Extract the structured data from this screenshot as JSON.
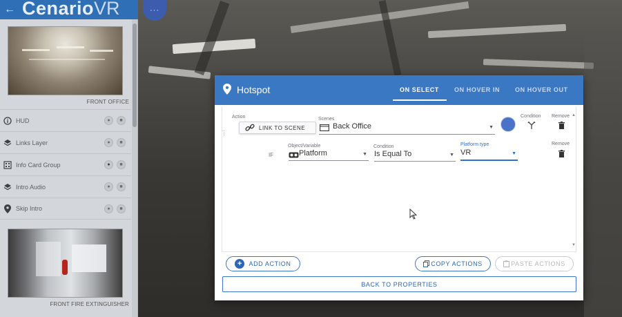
{
  "app": {
    "brand": "Cenario",
    "brand_suffix": "VR",
    "back_glyph": "←",
    "menu_glyph": "···"
  },
  "sidebar": {
    "scenes": [
      {
        "caption": "FRONT OFFICE",
        "thumbnail": "office-panorama"
      },
      {
        "caption": "FRONT FIRE EXTINGUISHER",
        "thumbnail": "corridor-panorama"
      }
    ],
    "layers": [
      {
        "label": "HUD",
        "icon": "info-circle-icon"
      },
      {
        "label": "Links Layer",
        "icon": "layers-icon"
      },
      {
        "label": "Info Card Group",
        "icon": "grid-icon"
      },
      {
        "label": "Intro Audio",
        "icon": "layers-icon"
      },
      {
        "label": "Skip Intro",
        "icon": "map-pin-icon"
      }
    ]
  },
  "dialog": {
    "title": "Hotspot",
    "tabs": [
      {
        "label": "ON SELECT",
        "active": true
      },
      {
        "label": "ON HOVER IN",
        "active": false
      },
      {
        "label": "ON HOVER OUT",
        "active": false
      }
    ],
    "action": {
      "action_label": "Action",
      "action_button": "LINK TO SCENE",
      "scenes_label": "Scenes",
      "scene_value": "Back Office",
      "condition_label": "Condition",
      "remove_label": "Remove",
      "swatch_color": "#4a72c9"
    },
    "condition_row": {
      "if_label": "IF",
      "object_label": "Object/Variable",
      "object_value": "Platform",
      "condition_label": "Condition",
      "condition_value": "Is Equal To",
      "platform_label": "Platform type",
      "platform_value": "VR",
      "remove_label": "Remove"
    },
    "footer": {
      "add_action": "ADD ACTION",
      "copy_actions": "COPY ACTIONS",
      "paste_actions": "PASTE ACTIONS",
      "back_to_properties": "BACK TO PROPERTIES"
    }
  },
  "colors": {
    "brand_blue": "#2f6fb6",
    "header_blue": "#3b78c4",
    "accent_blue": "#2c67b3"
  }
}
